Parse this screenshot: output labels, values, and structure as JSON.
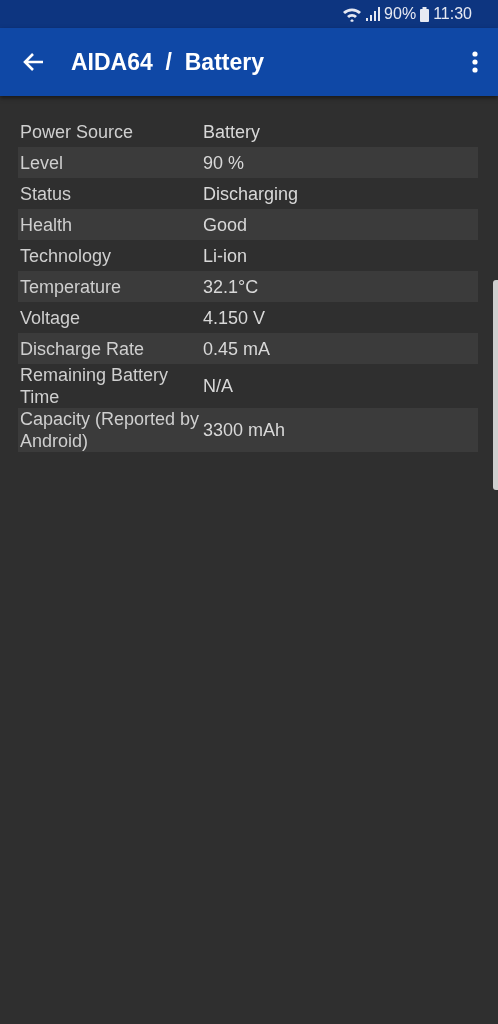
{
  "status_bar": {
    "battery": "90%",
    "time": "11:30"
  },
  "app_bar": {
    "title": "AIDA64  /  Battery"
  },
  "table": {
    "rows": [
      {
        "label": "Power Source",
        "value": "Battery"
      },
      {
        "label": "Level",
        "value": "90 %"
      },
      {
        "label": "Status",
        "value": "Discharging"
      },
      {
        "label": "Health",
        "value": "Good"
      },
      {
        "label": "Technology",
        "value": "Li-ion"
      },
      {
        "label": "Temperature",
        "value": "32.1°C"
      },
      {
        "label": "Voltage",
        "value": "4.150 V"
      },
      {
        "label": "Discharge Rate",
        "value": "0.45 mA"
      },
      {
        "label": "Remaining Battery Time",
        "value": "N/A"
      },
      {
        "label": "Capacity (Reported by Android)",
        "value": "3300 mAh"
      }
    ]
  }
}
